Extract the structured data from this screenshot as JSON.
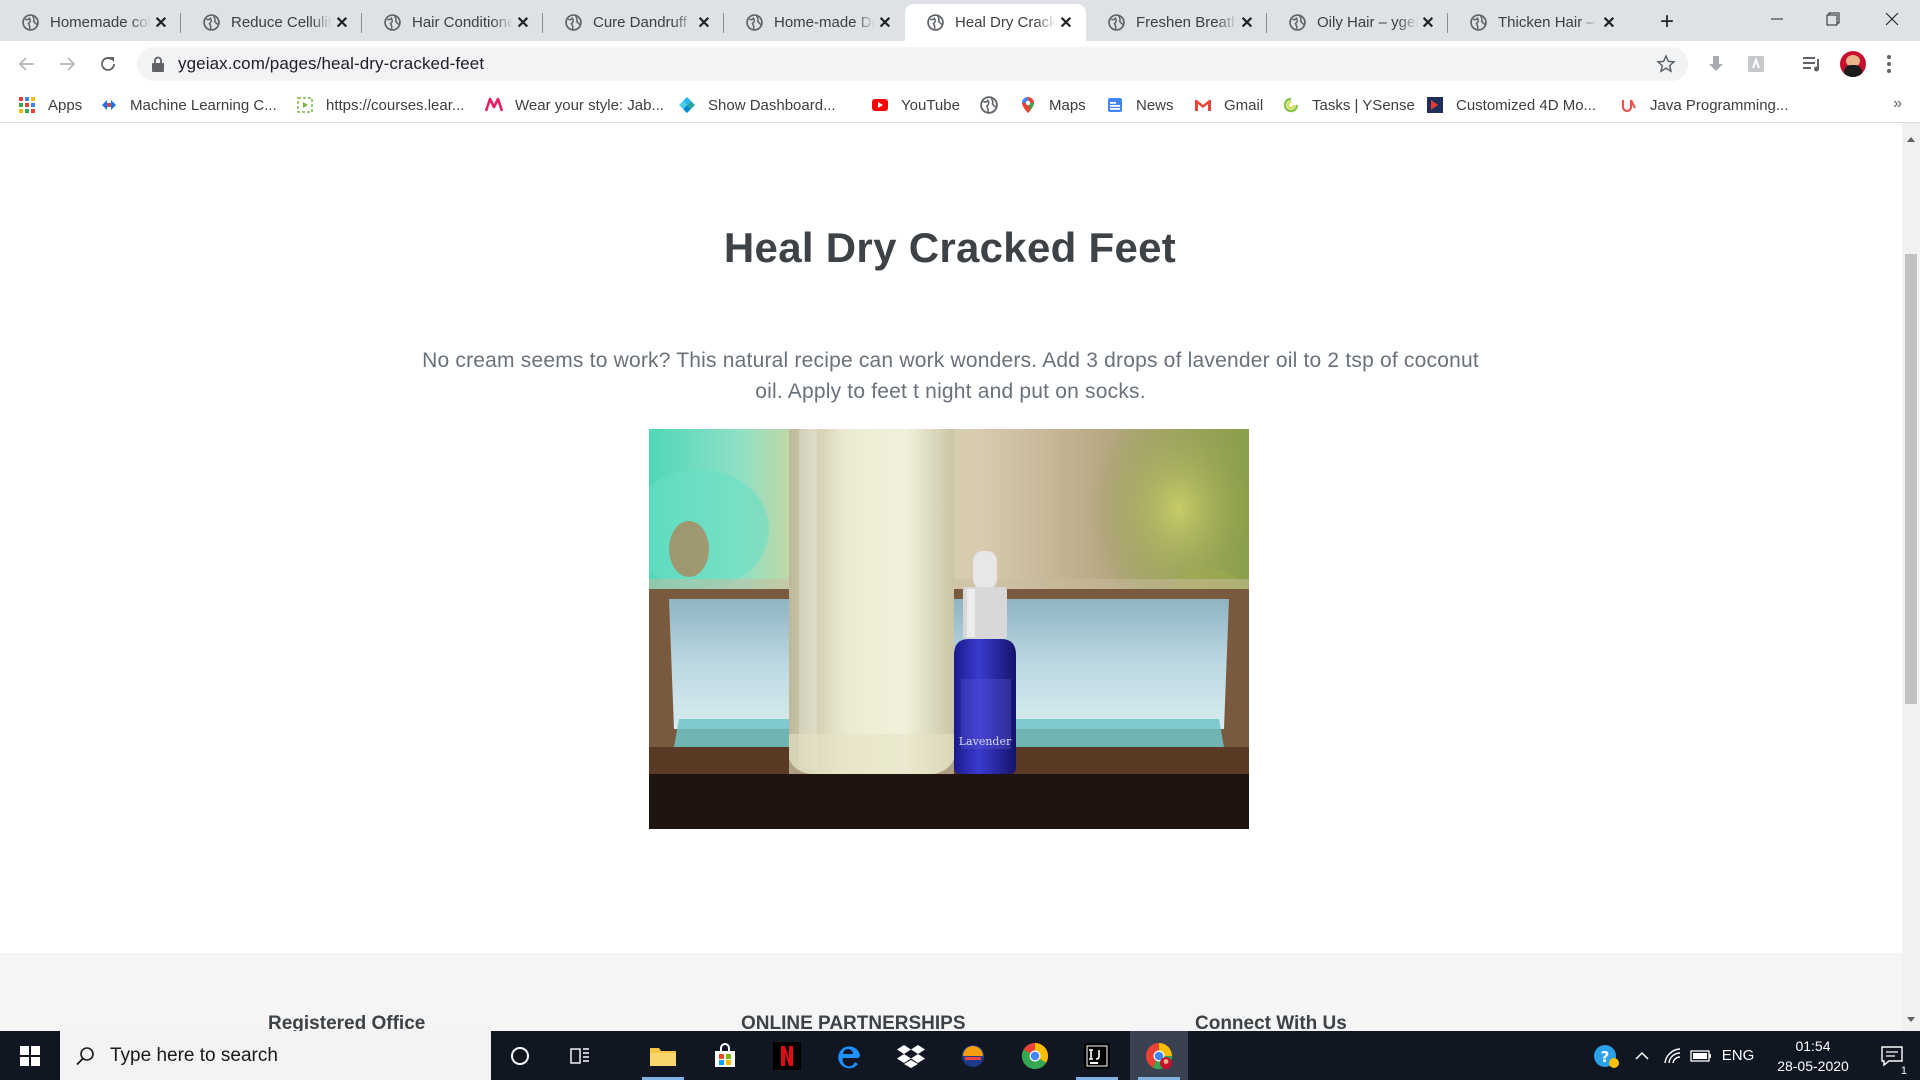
{
  "browser": {
    "tabs": [
      {
        "title": "Homemade cold"
      },
      {
        "title": "Reduce Cellulite"
      },
      {
        "title": "Hair Conditioner"
      },
      {
        "title": "Cure Dandruff"
      },
      {
        "title": "Home-made Deo"
      },
      {
        "title": "Heal Dry Cracked Feet",
        "active": true
      },
      {
        "title": "Freshen Breath"
      },
      {
        "title": "Oily Hair – ygeiax"
      },
      {
        "title": "Thicken Hair – ygeiax"
      }
    ],
    "close_glyph": "✕",
    "new_tab_glyph": "+",
    "url": "ygeiax.com/pages/heal-dry-cracked-feet",
    "bookmarks": [
      {
        "label": "Apps",
        "icon": "apps-grid-icon"
      },
      {
        "label": "Machine Learning C...",
        "icon": "ml-course-icon"
      },
      {
        "label": "https://courses.lear...",
        "icon": "courses-icon"
      },
      {
        "label": "Wear your style: Jab...",
        "icon": "myntra-icon"
      },
      {
        "label": "Show Dashboard...",
        "icon": "dashboard-icon"
      },
      {
        "label": "YouTube",
        "icon": "youtube-icon"
      },
      {
        "label": "",
        "icon": "globe-icon"
      },
      {
        "label": "Maps",
        "icon": "maps-icon"
      },
      {
        "label": "News",
        "icon": "news-icon"
      },
      {
        "label": "Gmail",
        "icon": "gmail-icon"
      },
      {
        "label": "Tasks | YSense",
        "icon": "ysense-icon"
      },
      {
        "label": "Customized 4D Mo...",
        "icon": "4d-icon"
      },
      {
        "label": "Java Programming...",
        "icon": "udemy-icon"
      }
    ],
    "bookmarks_more": "»"
  },
  "page": {
    "title": "Heal Dry Cracked Feet",
    "text": "No cream seems to work? This natural recipe can work wonders. Add 3 drops of lavender oil to 2 tsp of coconut oil. Apply to feet t night and put on socks.",
    "photo_label": "Lavender",
    "footer": {
      "col1": "Registered Office",
      "col2": "ONLINE PARTNERSHIPS",
      "col3": "Connect With Us"
    }
  },
  "taskbar": {
    "search_placeholder": "Type here to search",
    "language": "ENG",
    "time": "01:54",
    "date": "28-05-2020",
    "notification_count": "1"
  },
  "colors": {
    "tabstrip": "#dee1e6",
    "title_text": "#3d4246",
    "body_text": "#69727b",
    "taskbar": "#101723"
  }
}
